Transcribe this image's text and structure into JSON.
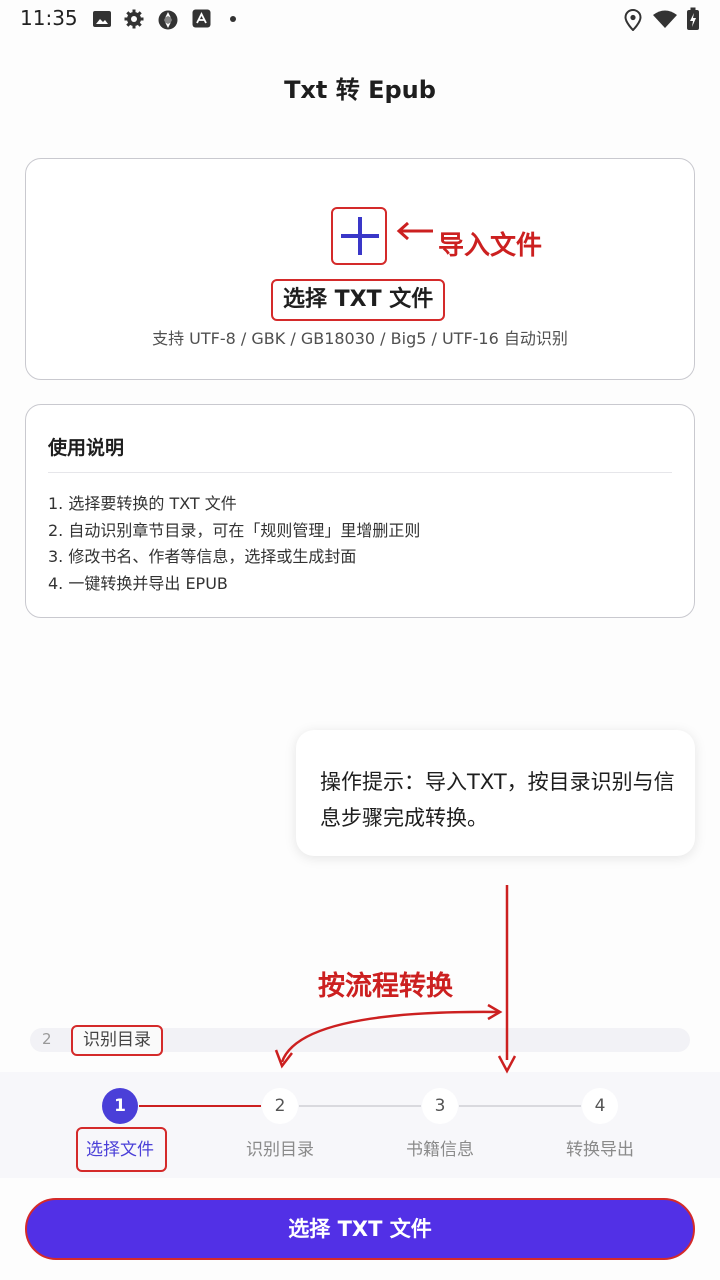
{
  "status_bar": {
    "time": "11:35",
    "icons": [
      "image-icon",
      "gear-icon",
      "aperture-icon",
      "app-store-icon",
      "dot-icon",
      "location-icon",
      "wifi-icon",
      "battery-charging-icon"
    ]
  },
  "header": {
    "title": "Txt 转 Epub"
  },
  "import_card": {
    "annotation": "导入文件",
    "select_title": "选择 TXT 文件",
    "encoding_note": "支持 UTF-8 / GBK / GB18030 / Big5 / UTF-16 自动识别"
  },
  "instructions": {
    "title": "使用说明",
    "items": [
      "1. 选择要转换的 TXT 文件",
      "2. 自动识别章节目录，可在「规则管理」里增删正则",
      "3. 修改书名、作者等信息，选择或生成封面",
      "4. 一键转换并导出 EPUB"
    ]
  },
  "tip": {
    "text": "操作提示：导入TXT，按目录识别与信息步骤完成转换。"
  },
  "flow_annotation": {
    "label": "按流程转换"
  },
  "peek": {
    "number": "2",
    "label": "识别目录"
  },
  "steps": [
    {
      "number": "1",
      "label": "选择文件",
      "active": true
    },
    {
      "number": "2",
      "label": "识别目录",
      "active": false
    },
    {
      "number": "3",
      "label": "书籍信息",
      "active": false
    },
    {
      "number": "4",
      "label": "转换导出",
      "active": false
    }
  ],
  "primary_button": {
    "label": "选择 TXT 文件"
  },
  "colors": {
    "accent": "#5230e6",
    "annotation": "#cc2020",
    "plus": "#3a37c8"
  }
}
